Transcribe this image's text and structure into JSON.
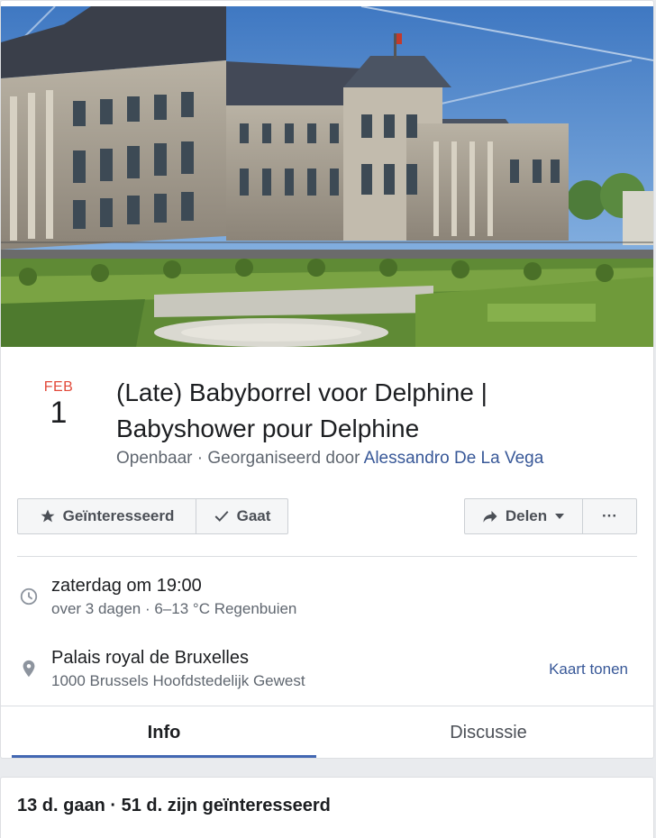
{
  "event": {
    "month": "FEB",
    "day": "1",
    "title": "(Late) Babyborrel voor Delphine | Babyshower pour Delphine",
    "privacy": "Openbaar",
    "separator": " · ",
    "organized_by": "Georganiseerd door",
    "organizer": "Alessandro De La Vega"
  },
  "actions": {
    "interested": "Geïnteresseerd",
    "going": "Gaat",
    "share": "Delen",
    "more": "···"
  },
  "details": {
    "time_primary": "zaterdag om 19:00",
    "time_secondary": "over 3 dagen · 6–13 °C Regenbuien",
    "place_primary": "Palais royal de Bruxelles",
    "place_secondary": "1000 Brussels Hoofdstedelijk Gewest",
    "map_link": "Kaart tonen"
  },
  "tabs": [
    {
      "label": "Info",
      "active": true
    },
    {
      "label": "Discussie",
      "active": false
    }
  ],
  "stats": "13 d. gaan · 51 d. zijn geïnteresseerd",
  "colors": {
    "accent": "#4267b2",
    "link": "#385898",
    "month": "#e24a3a"
  },
  "icons": {
    "interested": "star-icon",
    "going": "checkmark-icon",
    "share": "share-arrow-icon",
    "share_dropdown": "caret-down-icon",
    "time": "clock-icon",
    "place": "location-pin-icon"
  }
}
